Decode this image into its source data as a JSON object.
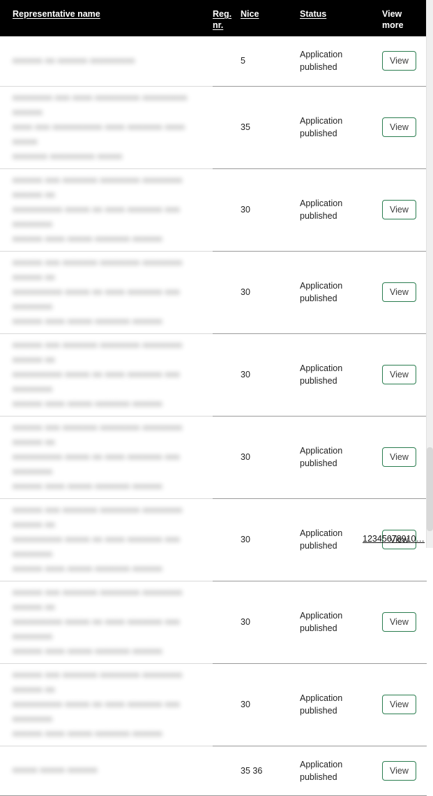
{
  "table": {
    "columns": [
      {
        "key": "name",
        "label": "Representative name",
        "sortable": true,
        "wrap": false
      },
      {
        "key": "reg",
        "label": "Reg. nr.",
        "sortable": true,
        "wrap": true
      },
      {
        "key": "nice",
        "label": "Nice",
        "sortable": true,
        "wrap": false
      },
      {
        "key": "status",
        "label": "Status",
        "sortable": true,
        "wrap": false
      },
      {
        "key": "view",
        "label": "View more",
        "sortable": false,
        "wrap": true
      }
    ],
    "header_bg": "#000000",
    "header_fg": "#ffffff",
    "rows": [
      {
        "name_redacted": true,
        "name_lines": [
          "nnnnnn nn nnnnnn nnnnnnnnn"
        ],
        "reg": "",
        "nice": "5",
        "status": "Application published",
        "action_label": "View"
      },
      {
        "name_redacted": true,
        "name_lines": [
          "nnnnnnnn nnn nnnn nnnnnnnnn nnnnnnnnn nnnnnn",
          "nnnn nnn nnnnnnnnnn nnnn nnnnnnn nnnn nnnnn",
          "nnnnnnn nnnnnnnnn nnnnn"
        ],
        "reg": "",
        "nice": "35",
        "status": "Application published",
        "action_label": "View"
      },
      {
        "name_redacted": true,
        "name_lines": [
          "nnnnnn nnn nnnnnnn nnnnnnnn nnnnnnnn nnnnnn nn",
          "nnnnnnnnnn nnnnn nn nnnn nnnnnnn nnn nnnnnnnn",
          "nnnnnn nnnn nnnnn nnnnnnn nnnnnn"
        ],
        "reg": "",
        "nice": "30",
        "status": "Application published",
        "action_label": "View"
      },
      {
        "name_redacted": true,
        "name_lines": [
          "nnnnnn nnn nnnnnnn nnnnnnnn nnnnnnnn nnnnnn nn",
          "nnnnnnnnnn nnnnn nn nnnn nnnnnnn nnn nnnnnnnn",
          "nnnnnn nnnn nnnnn nnnnnnn nnnnnn"
        ],
        "reg": "",
        "nice": "30",
        "status": "Application published",
        "action_label": "View"
      },
      {
        "name_redacted": true,
        "name_lines": [
          "nnnnnn nnn nnnnnnn nnnnnnnn nnnnnnnn nnnnnn nn",
          "nnnnnnnnnn nnnnn nn nnnn nnnnnnn nnn nnnnnnnn",
          "nnnnnn nnnn nnnnn nnnnnnn nnnnnn"
        ],
        "reg": "",
        "nice": "30",
        "status": "Application published",
        "action_label": "View"
      },
      {
        "name_redacted": true,
        "name_lines": [
          "nnnnnn nnn nnnnnnn nnnnnnnn nnnnnnnn nnnnnn nn",
          "nnnnnnnnnn nnnnn nn nnnn nnnnnnn nnn nnnnnnnn",
          "nnnnnn nnnn nnnnn nnnnnnn nnnnnn"
        ],
        "reg": "",
        "nice": "30",
        "status": "Application published",
        "action_label": "View"
      },
      {
        "name_redacted": true,
        "name_lines": [
          "nnnnnn nnn nnnnnnn nnnnnnnn nnnnnnnn nnnnnn nn",
          "nnnnnnnnnn nnnnn nn nnnn nnnnnnn nnn nnnnnnnn",
          "nnnnnn nnnn nnnnn nnnnnnn nnnnnn"
        ],
        "reg": "",
        "nice": "30",
        "status": "Application published",
        "action_label": "View"
      },
      {
        "name_redacted": true,
        "name_lines": [
          "nnnnnn nnn nnnnnnn nnnnnnnn nnnnnnnn nnnnnn nn",
          "nnnnnnnnnn nnnnn nn nnnn nnnnnnn nnn nnnnnnnn",
          "nnnnnn nnnn nnnnn nnnnnnn nnnnnn"
        ],
        "reg": "",
        "nice": "30",
        "status": "Application published",
        "action_label": "View"
      },
      {
        "name_redacted": true,
        "name_lines": [
          "nnnnnn nnn nnnnnnn nnnnnnnn nnnnnnnn nnnnnn nn",
          "nnnnnnnnnn nnnnn nn nnnn nnnnnnn nnn nnnnnnnn",
          "nnnnnn nnnn nnnnn nnnnnnn nnnnnn"
        ],
        "reg": "",
        "nice": "30",
        "status": "Application published",
        "action_label": "View"
      },
      {
        "name_redacted": true,
        "name_lines": [
          "nnnnn nnnnn nnnnnn"
        ],
        "reg": "",
        "nice": "35 36",
        "status": "Application published",
        "action_label": "View"
      }
    ]
  },
  "pagination": {
    "pages": [
      "1",
      "2",
      "3",
      "4",
      "5",
      "6",
      "7",
      "8",
      "9",
      "10"
    ],
    "ellipsis": "…",
    "current": "1"
  },
  "colors": {
    "accent_green": "#2a7d4f",
    "header_bg": "#000000",
    "row_divider": "#9a9a9a",
    "text": "#222222"
  }
}
